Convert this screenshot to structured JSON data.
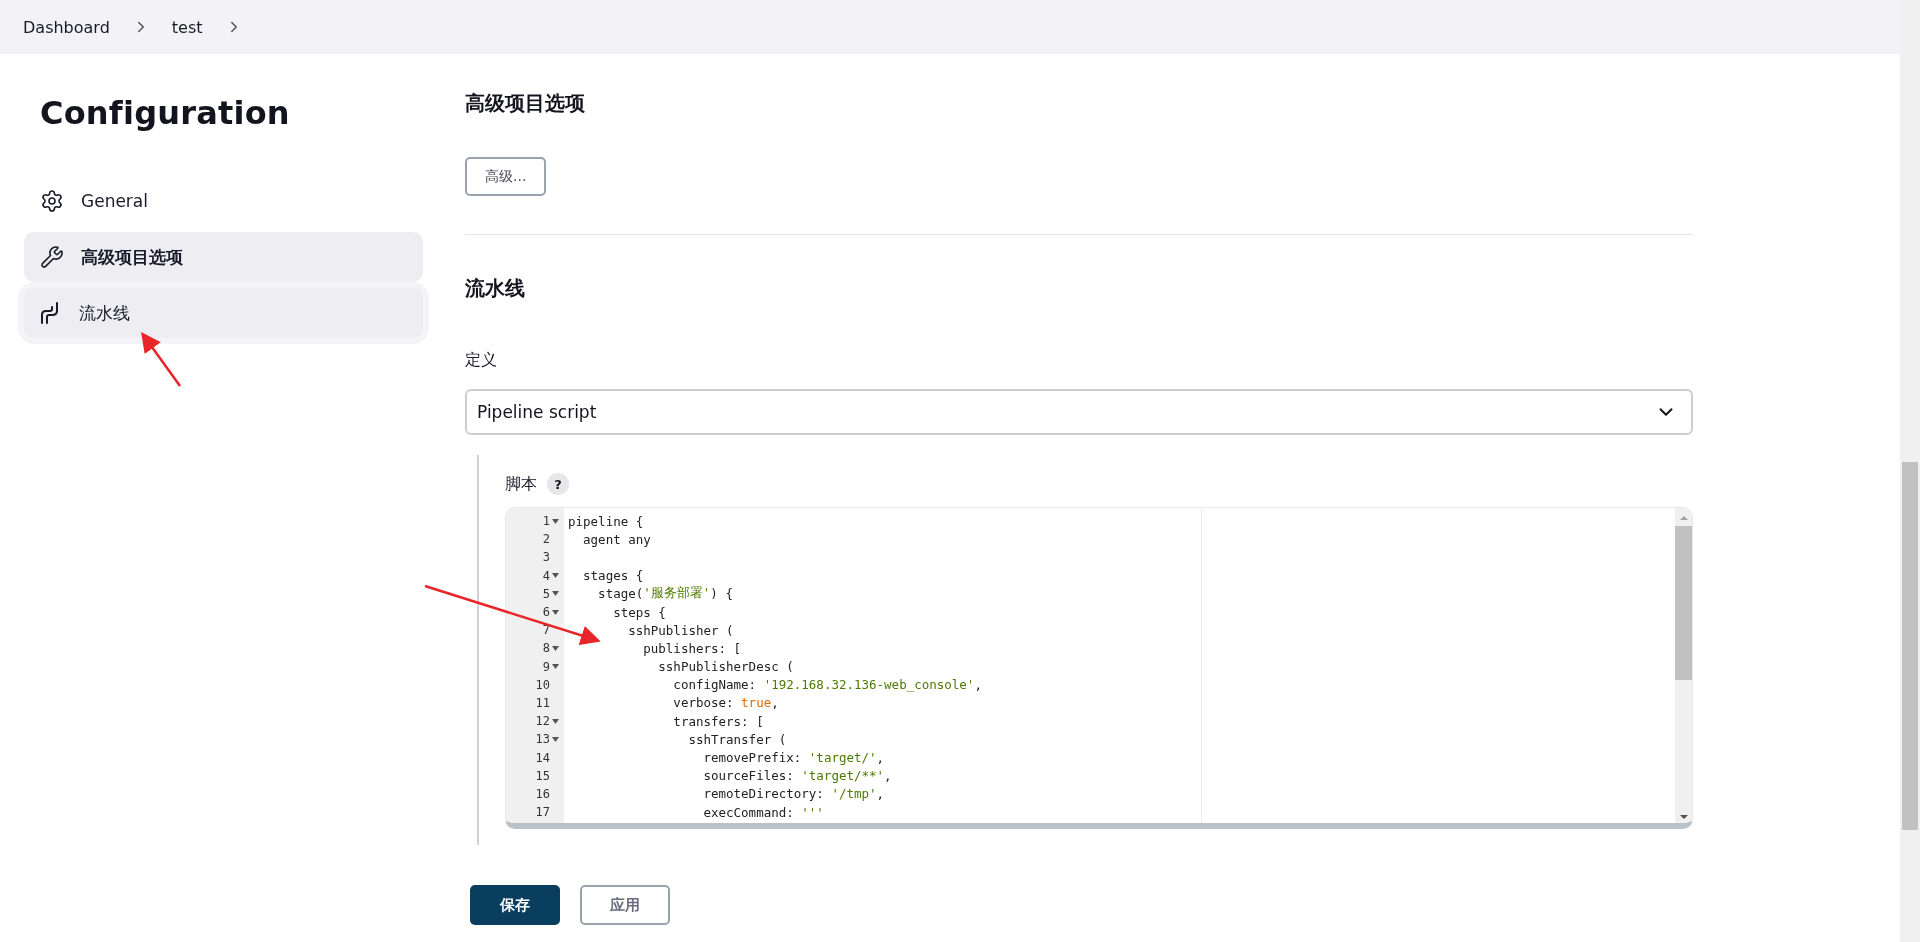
{
  "breadcrumb": [
    {
      "label": "Dashboard"
    },
    {
      "label": "test"
    }
  ],
  "sidebar": {
    "title": "Configuration",
    "items": [
      {
        "label": "General",
        "selected": false,
        "hovered": false
      },
      {
        "label": "高级项目选项",
        "selected": true,
        "hovered": false
      },
      {
        "label": "流水线",
        "selected": false,
        "hovered": true
      }
    ]
  },
  "advanced": {
    "title": "高级项目选项",
    "button": "高级..."
  },
  "pipeline": {
    "title": "流水线",
    "definition_label": "定义",
    "definition_value": "Pipeline script",
    "script_label": "脚本",
    "help": "?",
    "lines": [
      {
        "number": "1",
        "fold": true,
        "tokens": [
          {
            "text": "pipeline {",
            "kind": "plain"
          }
        ]
      },
      {
        "number": "2",
        "fold": false,
        "tokens": [
          {
            "text": "  agent any",
            "kind": "plain"
          }
        ]
      },
      {
        "number": "3",
        "fold": false
      },
      {
        "number": "4",
        "fold": true,
        "tokens": [
          {
            "text": "  stages {",
            "kind": "plain"
          }
        ]
      },
      {
        "number": "5",
        "fold": true,
        "tokens": [
          {
            "text": "    stage(",
            "kind": "plain"
          },
          {
            "text": "'服务部署'",
            "kind": "string"
          },
          {
            "text": ") {",
            "kind": "plain"
          }
        ]
      },
      {
        "number": "6",
        "fold": true,
        "tokens": [
          {
            "text": "      steps {",
            "kind": "plain"
          }
        ]
      },
      {
        "number": "7",
        "fold": false,
        "tokens": [
          {
            "text": "        sshPublisher (",
            "kind": "plain"
          }
        ]
      },
      {
        "number": "8",
        "fold": true,
        "tokens": [
          {
            "text": "          publishers: [",
            "kind": "plain"
          }
        ]
      },
      {
        "number": "9",
        "fold": true,
        "tokens": [
          {
            "text": "            sshPublisherDesc (",
            "kind": "plain"
          }
        ]
      },
      {
        "number": "10",
        "fold": false,
        "tokens": [
          {
            "text": "              configName: ",
            "kind": "plain"
          },
          {
            "text": "'192.168.32.136-web_console'",
            "kind": "string"
          },
          {
            "text": ",",
            "kind": "plain"
          }
        ]
      },
      {
        "number": "11",
        "fold": false,
        "tokens": [
          {
            "text": "              verbose: ",
            "kind": "plain"
          },
          {
            "text": "true",
            "kind": "keyword"
          },
          {
            "text": ",",
            "kind": "plain"
          }
        ]
      },
      {
        "number": "12",
        "fold": true,
        "tokens": [
          {
            "text": "              transfers: [",
            "kind": "plain"
          }
        ]
      },
      {
        "number": "13",
        "fold": true,
        "tokens": [
          {
            "text": "                sshTransfer (",
            "kind": "plain"
          }
        ]
      },
      {
        "number": "14",
        "fold": false,
        "tokens": [
          {
            "text": "                  removePrefix: ",
            "kind": "plain"
          },
          {
            "text": "'target/'",
            "kind": "string"
          },
          {
            "text": ",",
            "kind": "plain"
          }
        ]
      },
      {
        "number": "15",
        "fold": false,
        "tokens": [
          {
            "text": "                  sourceFiles: ",
            "kind": "plain"
          },
          {
            "text": "'target/**'",
            "kind": "string"
          },
          {
            "text": ",",
            "kind": "plain"
          }
        ]
      },
      {
        "number": "16",
        "fold": false,
        "tokens": [
          {
            "text": "                  remoteDirectory: ",
            "kind": "plain"
          },
          {
            "text": "'/tmp'",
            "kind": "string"
          },
          {
            "text": ",",
            "kind": "plain"
          }
        ]
      },
      {
        "number": "17",
        "fold": false,
        "tokens": [
          {
            "text": "                  execCommand: ",
            "kind": "plain"
          },
          {
            "text": "'''",
            "kind": "string"
          }
        ]
      }
    ]
  },
  "footer": {
    "buttons": [
      {
        "label": "保存",
        "kind": "primary"
      },
      {
        "label": "应用",
        "kind": "secondary"
      }
    ]
  }
}
